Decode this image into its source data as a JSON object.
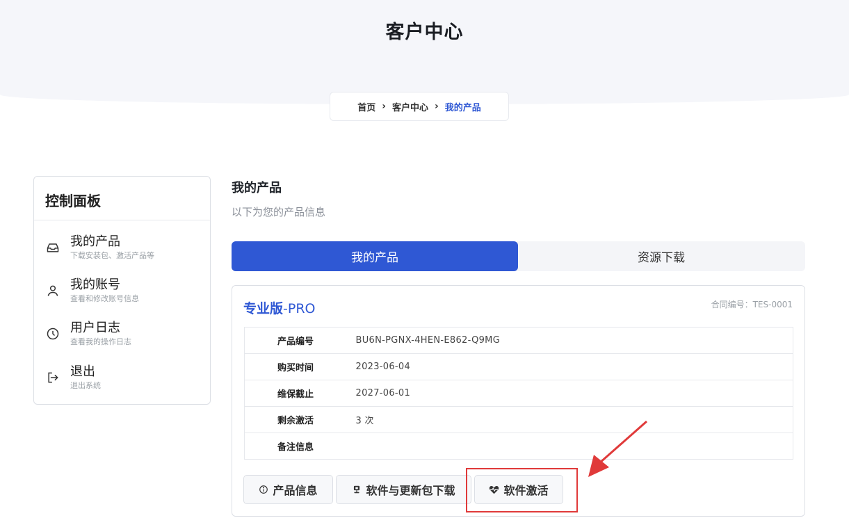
{
  "header": {
    "title": "客户中心"
  },
  "breadcrumb": {
    "home": "首页",
    "center": "客户中心",
    "current": "我的产品"
  },
  "sidebar": {
    "title": "控制面板",
    "items": [
      {
        "label": "我的产品",
        "desc": "下载安装包、激活产品等",
        "icon": "inbox-icon"
      },
      {
        "label": "我的账号",
        "desc": "查看和修改账号信息",
        "icon": "user-icon"
      },
      {
        "label": "用户日志",
        "desc": "查看我的操作日志",
        "icon": "clock-icon"
      },
      {
        "label": "退出",
        "desc": "退出系统",
        "icon": "logout-icon"
      }
    ]
  },
  "main": {
    "title": "我的产品",
    "subtitle": "以下为您的产品信息",
    "tabs": [
      {
        "label": "我的产品",
        "active": true
      },
      {
        "label": "资源下载",
        "active": false
      }
    ]
  },
  "product": {
    "name_main": "专业版",
    "name_suffix": "-PRO",
    "contract": "合同编号：TES-0001",
    "rows": [
      {
        "key": "产品编号",
        "value": "BU6N-PGNX-4HEN-E862-Q9MG"
      },
      {
        "key": "购买时间",
        "value": "2023-06-04"
      },
      {
        "key": "维保截止",
        "value": "2027-06-01"
      },
      {
        "key": "剩余激活",
        "value": "3 次"
      },
      {
        "key": "备注信息",
        "value": ""
      }
    ],
    "buttons": {
      "info": "产品信息",
      "download": "软件与更新包下载",
      "activate": "软件激活"
    }
  },
  "colors": {
    "accent": "#2f58d4",
    "annotation": "#e03a3a"
  }
}
